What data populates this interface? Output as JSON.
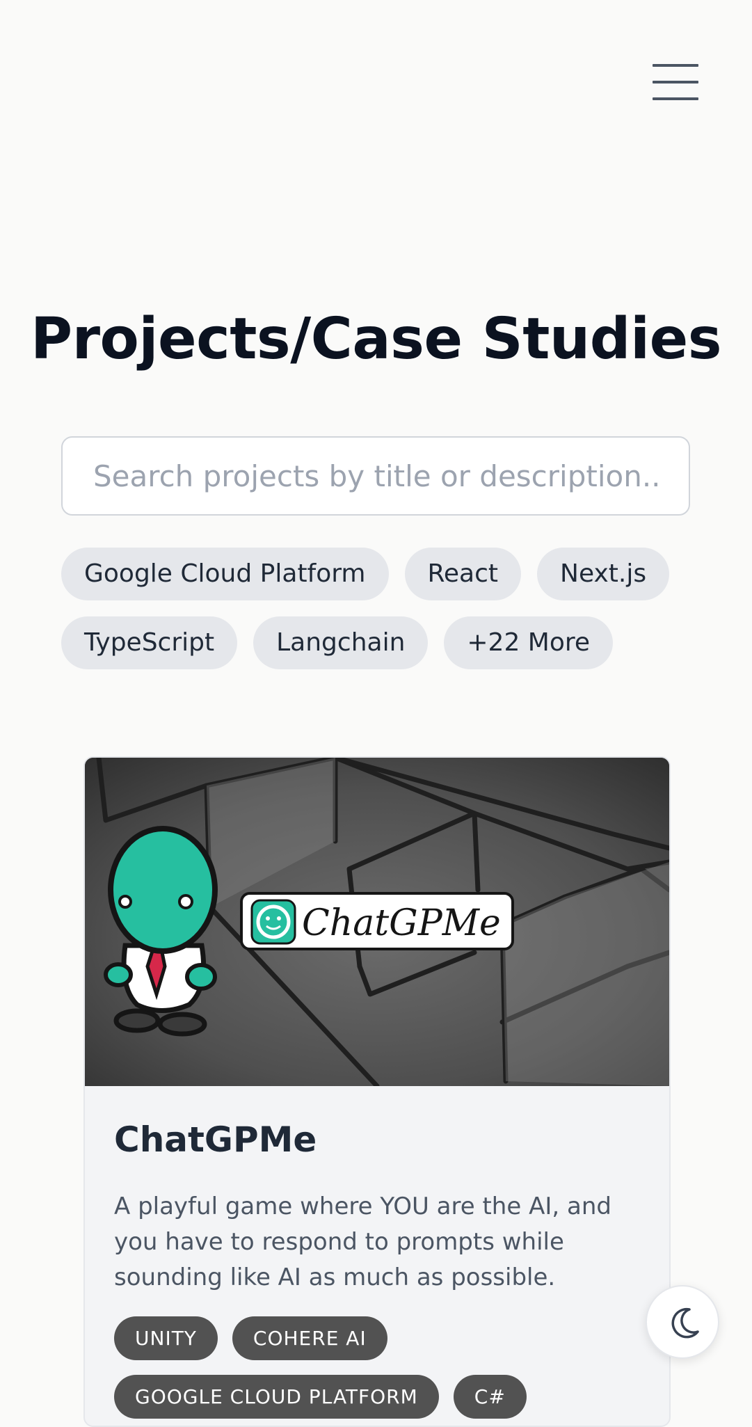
{
  "header": {
    "menu_icon": "hamburger-menu-icon"
  },
  "page": {
    "title": "Projects/Case Studies"
  },
  "search": {
    "value": "",
    "placeholder": "Search projects by title or description..."
  },
  "filters": {
    "row1": [
      "Google Cloud Platform",
      "React",
      "Next.js"
    ],
    "row2": [
      "TypeScript",
      "Langchain",
      "+22 More"
    ]
  },
  "project": {
    "image_text": "ChatGPMe",
    "title": "ChatGPMe",
    "description": "A playful game where YOU are the AI, and you have to respond to prompts while sounding like AI as much as possible.",
    "tags": [
      "UNITY",
      "COHERE AI",
      "GOOGLE CLOUD PLATFORM",
      "C#"
    ]
  },
  "theme_toggle": {
    "icon": "moon-icon"
  },
  "colors": {
    "background": "#fafaf9",
    "tag_bg": "#e5e7eb",
    "tech_tag_bg": "#525252",
    "mascot_green": "#26bfa0",
    "tie_red": "#d6284a"
  }
}
